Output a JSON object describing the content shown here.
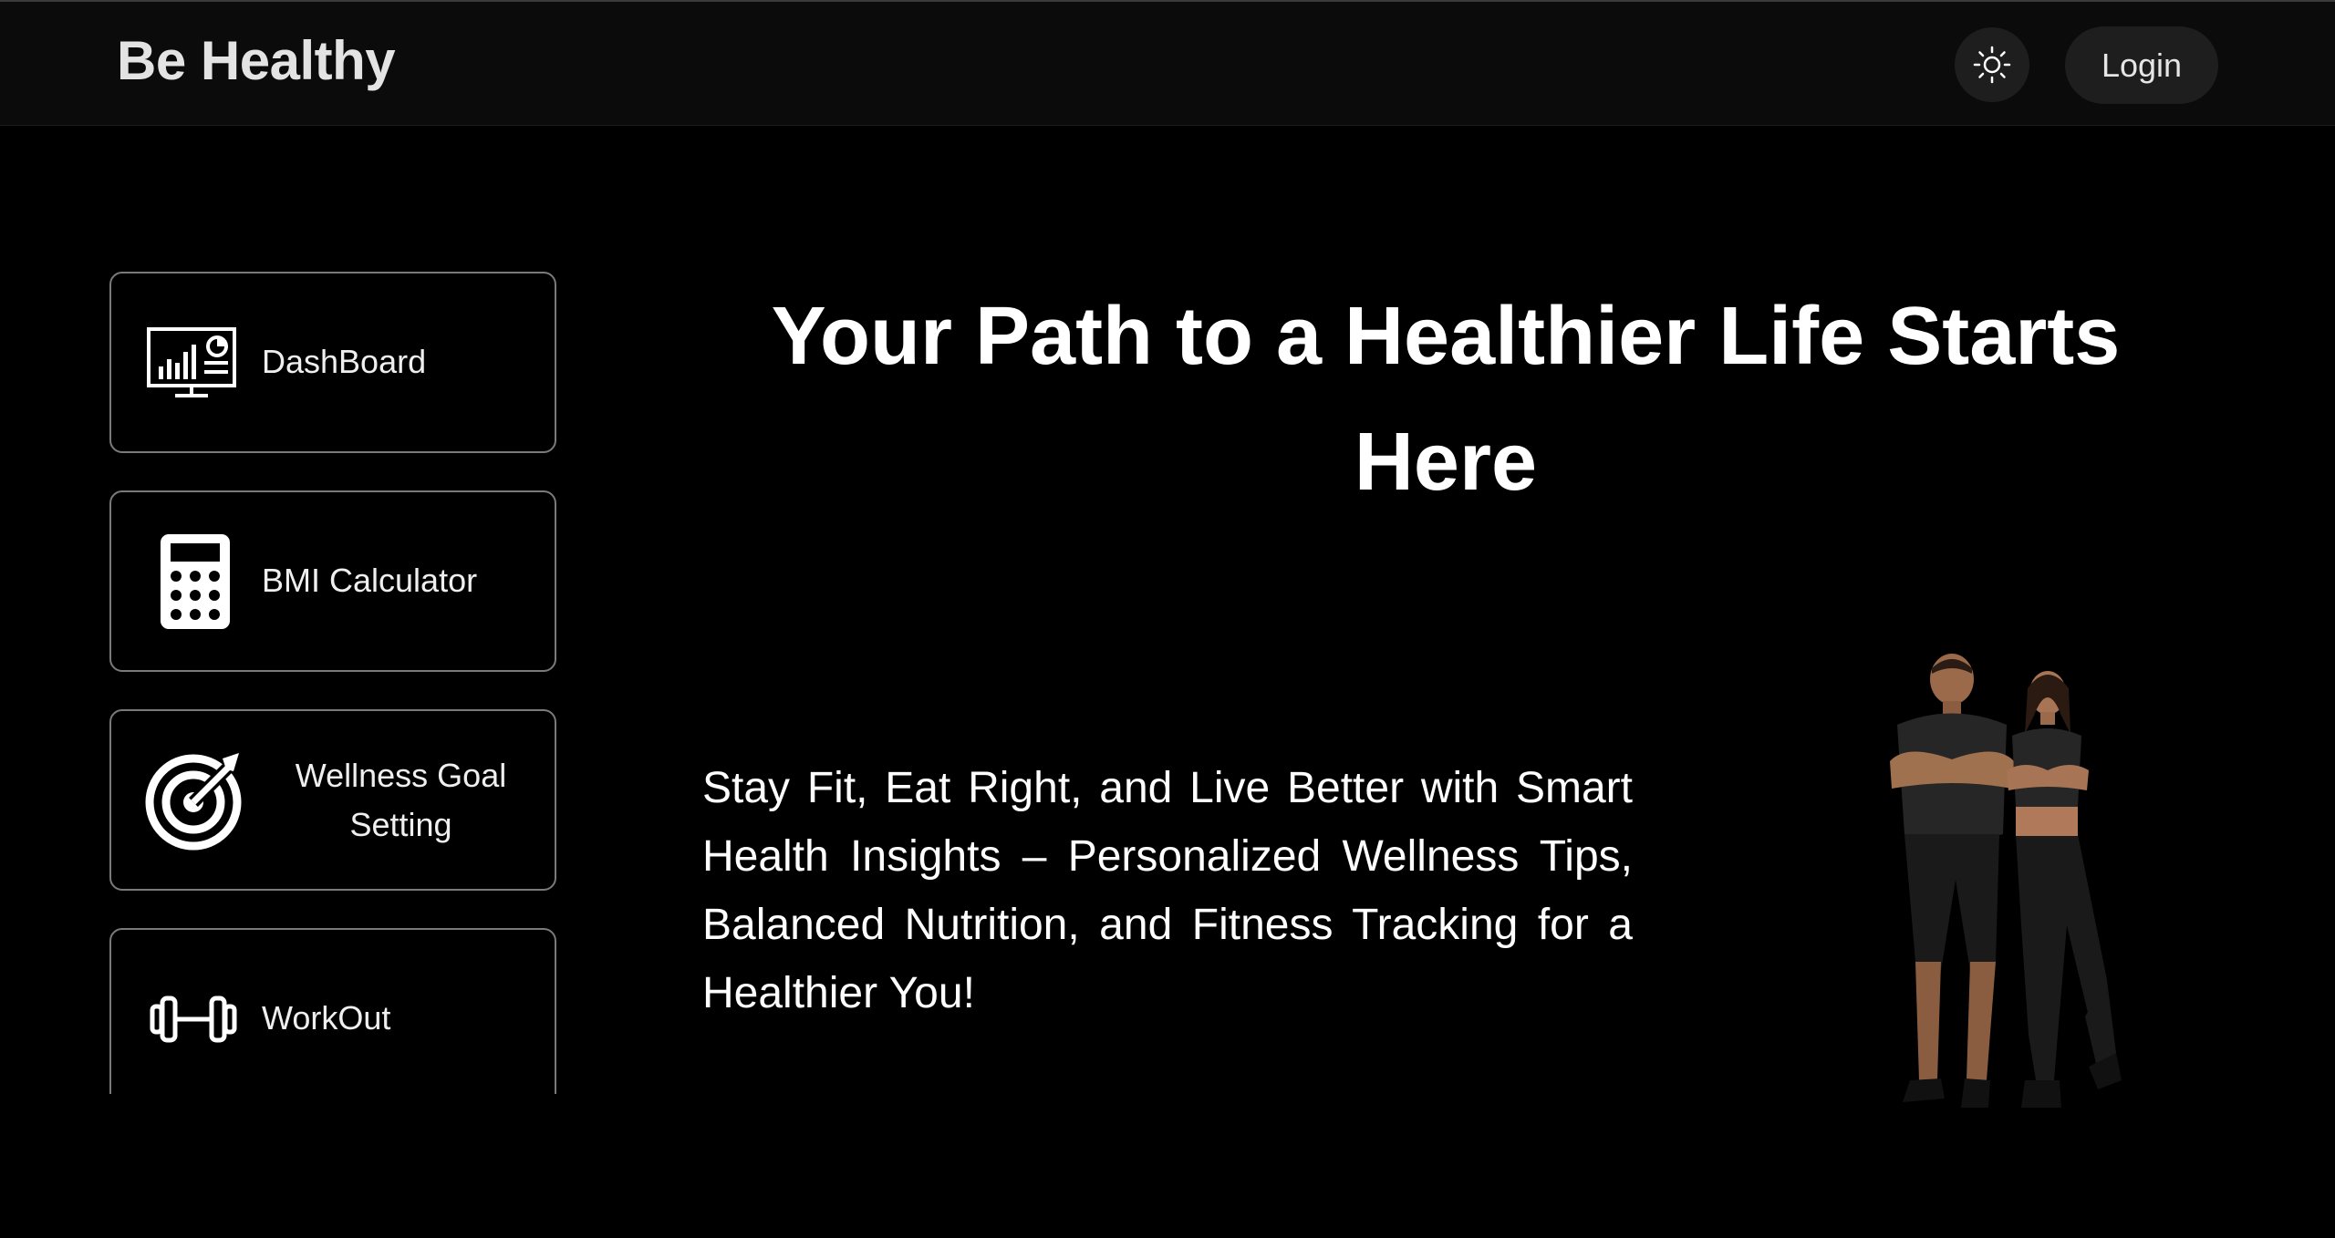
{
  "header": {
    "brand": "Be Healthy",
    "theme_toggle_icon": "sun-icon",
    "login_label": "Login"
  },
  "sidebar": {
    "items": [
      {
        "label": "DashBoard",
        "icon": "dashboard-chart-icon"
      },
      {
        "label": "BMI Calculator",
        "icon": "calculator-icon"
      },
      {
        "label": "Wellness Goal Setting",
        "icon": "target-icon"
      },
      {
        "label": "WorkOut",
        "icon": "dumbbell-icon"
      }
    ]
  },
  "hero": {
    "title": "Your Path to a Healthier Life Starts Here",
    "description": "Stay Fit, Eat Right, and Live Better with Smart Health Insights – Personalized Wellness Tips, Balanced Nutrition, and Fitness Tracking for a Healthier You!",
    "image_icon": "fitness-couple-image"
  },
  "colors": {
    "background": "#000000",
    "topbar": "#0b0b0b",
    "button_bg": "#1e1e1e",
    "card_border": "#7a7a7a",
    "text": "#ffffff"
  }
}
